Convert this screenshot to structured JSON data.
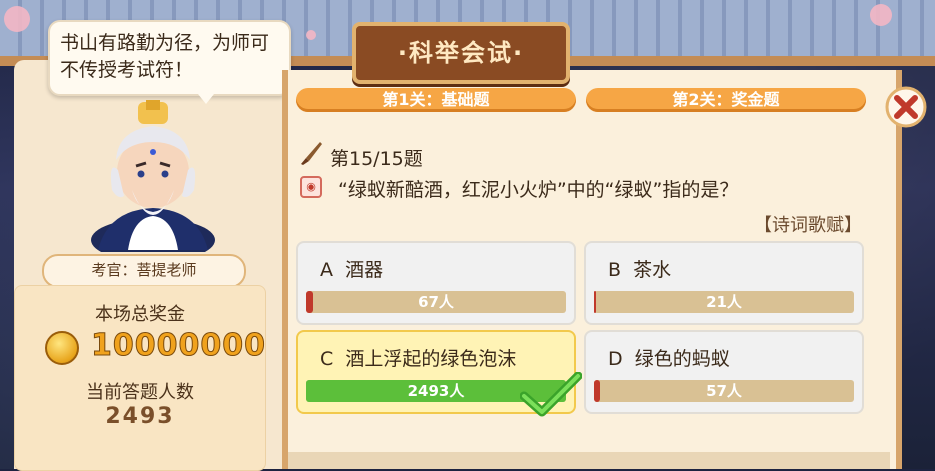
{
  "speech": {
    "text": "书山有路勤为径，为师可不传授考试符！"
  },
  "examiner": {
    "label": "考官：菩提老师"
  },
  "prize": {
    "title": "本场总奖金",
    "amount": "10000000"
  },
  "participants": {
    "title": "当前答题人数",
    "count": "2493"
  },
  "header": {
    "title": "·科举会试·"
  },
  "stages": [
    {
      "label": "第1关：基础题"
    },
    {
      "label": "第2关：奖金题"
    }
  ],
  "question": {
    "progress": "第15/15题",
    "text": "“绿蚁新醅酒，红泥小火炉”中的“绿蚁”指的是？",
    "category": "【诗词歌赋】"
  },
  "options": [
    {
      "letter": "A",
      "text": "酒器",
      "votes": "67人",
      "vote_count": 67,
      "selected": false
    },
    {
      "letter": "B",
      "text": "茶水",
      "votes": "21人",
      "vote_count": 21,
      "selected": false
    },
    {
      "letter": "C",
      "text": "酒上浮起的绿色泡沫",
      "votes": "2493人",
      "vote_count": 2493,
      "selected": true
    },
    {
      "letter": "D",
      "text": "绿色的蚂蚁",
      "votes": "57人",
      "vote_count": 57,
      "selected": false
    }
  ],
  "colors": {
    "accent": "#f6a645",
    "selected_bar": "#5cbf3a",
    "bar_bg": "#d9c194",
    "wrong_bar": "#c0392b"
  },
  "icons": {
    "close": "close-icon",
    "brush": "brush-icon",
    "check": "check-icon",
    "coin": "coin-icon"
  }
}
